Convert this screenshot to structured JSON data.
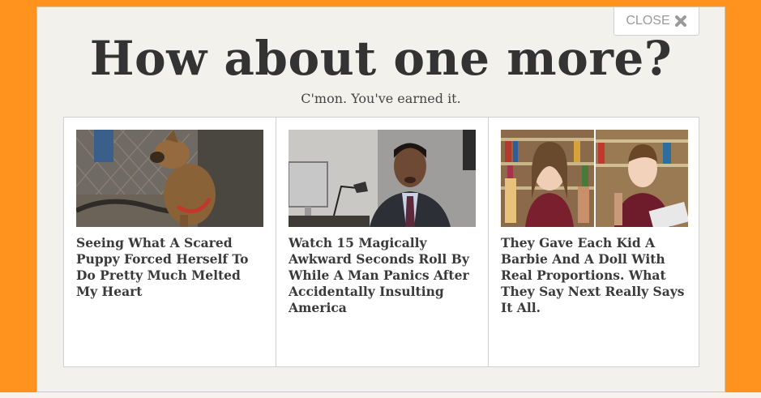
{
  "modal": {
    "close_label": "CLOSE",
    "headline": "How about one more?",
    "subtext": "C'mon. You've earned it."
  },
  "cards": [
    {
      "title": "Seeing What A Scared Puppy Forced Herself To Do Pretty Much Melted My Heart",
      "image": "scared-puppy-photo"
    },
    {
      "title": "Watch 15 Magically Awkward Seconds Roll By While A Man Panics After Accidentally Insulting America",
      "image": "man-in-suit-photo"
    },
    {
      "title": "They Gave Each Kid A Barbie And A Doll With Real Proportions. What They Say Next Really Says It All.",
      "image": "kids-with-dolls-photo"
    }
  ],
  "colors": {
    "background": "#ff931e",
    "modal": "#f2f1ec",
    "headline": "#333333"
  }
}
